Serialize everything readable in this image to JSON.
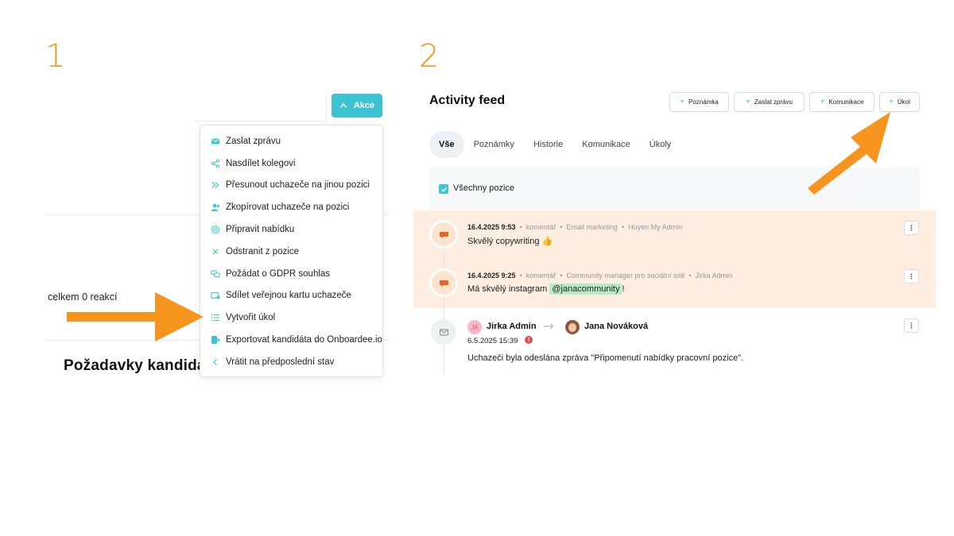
{
  "steps": {
    "one": "1",
    "two": "2"
  },
  "panel1": {
    "akce_label": "Akce",
    "menu": [
      {
        "label": "Zaslat zprávu",
        "icon": "envelope-icon"
      },
      {
        "label": "Nasdílet kolegovi",
        "icon": "share-icon"
      },
      {
        "label": "Přesunout uchazeče na jinou pozici",
        "icon": "move-arrows-icon"
      },
      {
        "label": "Zkopírovat uchazeče na pozici",
        "icon": "users-icon"
      },
      {
        "label": "Připravit nabídku",
        "icon": "offer-icon"
      },
      {
        "label": "Odstranit z pozice",
        "icon": "close-icon"
      },
      {
        "label": "Požádat o GDPR souhlas",
        "icon": "chat-bubbles-icon"
      },
      {
        "label": "Sdílet veřejnou kartu uchazeče",
        "icon": "card-share-icon"
      },
      {
        "label": "Vytvořit úkol",
        "icon": "checklist-icon"
      },
      {
        "label": "Exportovat kandidáta do Onboardee.io",
        "icon": "export-icon"
      },
      {
        "label": "Vrátit na předposlední stav",
        "icon": "back-arrow-icon"
      }
    ],
    "reactions": "celkem 0 reakcí",
    "requirements_title": "Požadavky kandidáta"
  },
  "panel2": {
    "title": "Activity feed",
    "buttons": {
      "note": "Poznámka",
      "message": "Zaslat zprávu",
      "communication": "Komunikace",
      "task": "Úkol"
    },
    "tabs": [
      "Vše",
      "Poznámky",
      "Historie",
      "Komunikace",
      "Úkoly"
    ],
    "filter_label": "Všechny pozice",
    "feed": [
      {
        "date": "16.4.2025 9:53",
        "type": "komentář",
        "position": "Email marketing",
        "author": "Huyen My Admin",
        "text": "Skvělý copywriting 👍"
      },
      {
        "date": "16.4.2025 9:25",
        "type": "komentář",
        "position": "Community manager pro sociální sítě",
        "author": "Jirka Admin",
        "text_before": "Má skvělý instagram",
        "mention": "@janacommunity",
        "text_after": "!"
      }
    ],
    "message": {
      "from_initials": "JA",
      "from": "Jirka Admin",
      "to": "Jana Nováková",
      "date": "6.5.2025 15:39",
      "error_mark": "!",
      "text": "Uchazeči byla odeslána zpráva \"Připomenutí nabídky pracovní pozice\"."
    }
  },
  "colors": {
    "accent": "#3ec3d5",
    "arrow": "#f7941d",
    "highlight": "#fdeee1",
    "mention": "#b7ecc5"
  }
}
